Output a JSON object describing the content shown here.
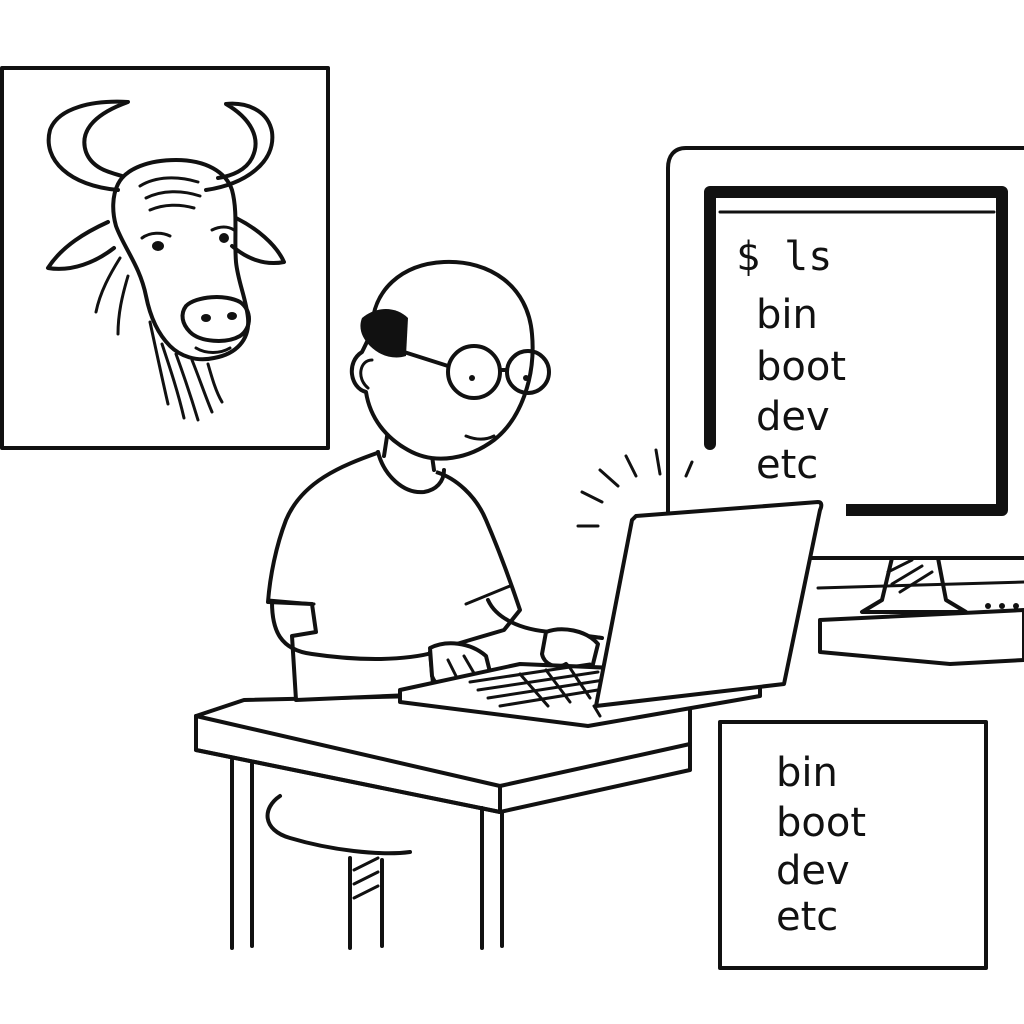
{
  "terminal": {
    "prompt": "$ ls",
    "lines": [
      "bin",
      "boot",
      "dev",
      "etc"
    ]
  },
  "listing": {
    "lines": [
      "bin",
      "boot",
      "dev",
      "etc"
    ]
  },
  "icons": {
    "poster": "gnu-head-icon",
    "person": "person-with-glasses",
    "laptop": "laptop-icon",
    "monitor": "monitor-icon"
  }
}
